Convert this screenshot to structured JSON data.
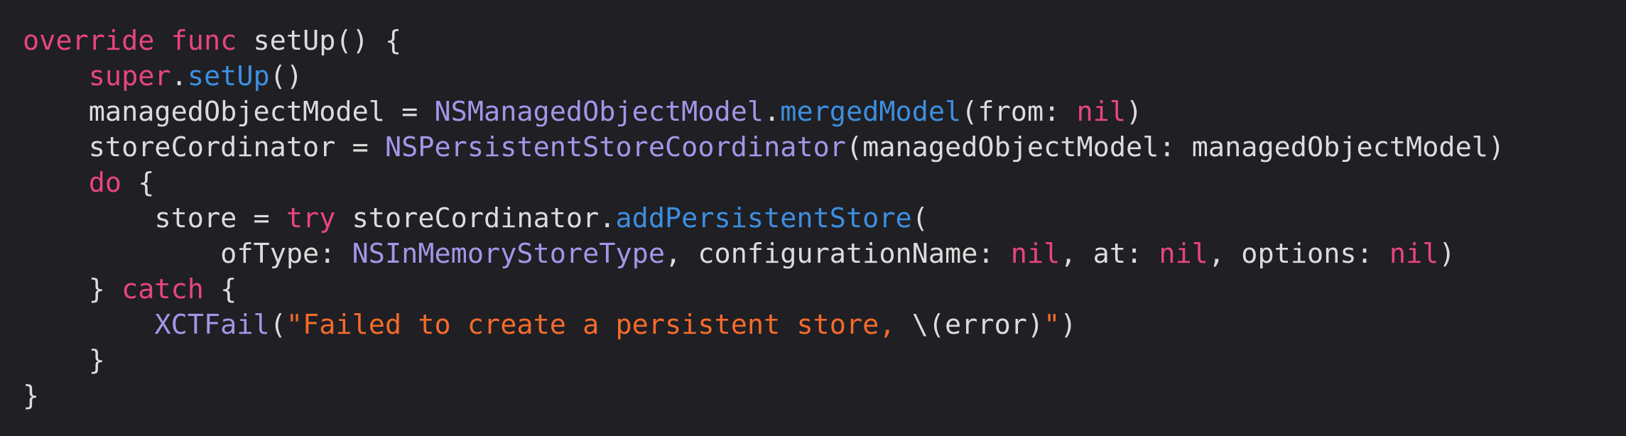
{
  "colors": {
    "background": "#1f1f24",
    "plain": "#dcdcdc",
    "keyword": "#e8457f",
    "type": "#a396e8",
    "function": "#3d8fe0",
    "string": "#f56b2b"
  },
  "code": {
    "lines": [
      {
        "indent": 0,
        "tokens": [
          {
            "kind": "kw",
            "text": "override func"
          },
          {
            "kind": "plain",
            "text": " setUp() {"
          }
        ]
      },
      {
        "indent": 1,
        "tokens": [
          {
            "kind": "kw",
            "text": "super"
          },
          {
            "kind": "plain",
            "text": "."
          },
          {
            "kind": "fn",
            "text": "setUp"
          },
          {
            "kind": "plain",
            "text": "()"
          }
        ]
      },
      {
        "indent": 1,
        "tokens": [
          {
            "kind": "plain",
            "text": "managedObjectModel = "
          },
          {
            "kind": "type",
            "text": "NSManagedObjectModel"
          },
          {
            "kind": "plain",
            "text": "."
          },
          {
            "kind": "fn",
            "text": "mergedModel"
          },
          {
            "kind": "plain",
            "text": "(from: "
          },
          {
            "kind": "kw",
            "text": "nil"
          },
          {
            "kind": "plain",
            "text": ")"
          }
        ]
      },
      {
        "indent": 1,
        "tokens": [
          {
            "kind": "plain",
            "text": "storeCordinator = "
          },
          {
            "kind": "type",
            "text": "NSPersistentStoreCoordinator"
          },
          {
            "kind": "plain",
            "text": "(managedObjectModel: managedObjectModel)"
          }
        ]
      },
      {
        "indent": 1,
        "tokens": [
          {
            "kind": "kw",
            "text": "do"
          },
          {
            "kind": "plain",
            "text": " {"
          }
        ]
      },
      {
        "indent": 2,
        "tokens": [
          {
            "kind": "plain",
            "text": "store = "
          },
          {
            "kind": "kw",
            "text": "try"
          },
          {
            "kind": "plain",
            "text": " storeCordinator."
          },
          {
            "kind": "fn",
            "text": "addPersistentStore"
          },
          {
            "kind": "plain",
            "text": "("
          }
        ]
      },
      {
        "indent": 3,
        "tokens": [
          {
            "kind": "plain",
            "text": "ofType: "
          },
          {
            "kind": "type",
            "text": "NSInMemoryStoreType"
          },
          {
            "kind": "plain",
            "text": ", configurationName: "
          },
          {
            "kind": "kw",
            "text": "nil"
          },
          {
            "kind": "plain",
            "text": ", at: "
          },
          {
            "kind": "kw",
            "text": "nil"
          },
          {
            "kind": "plain",
            "text": ", options: "
          },
          {
            "kind": "kw",
            "text": "nil"
          },
          {
            "kind": "plain",
            "text": ")"
          }
        ]
      },
      {
        "indent": 1,
        "tokens": [
          {
            "kind": "plain",
            "text": "} "
          },
          {
            "kind": "kw",
            "text": "catch"
          },
          {
            "kind": "plain",
            "text": " {"
          }
        ]
      },
      {
        "indent": 2,
        "tokens": [
          {
            "kind": "type",
            "text": "XCTFail"
          },
          {
            "kind": "plain",
            "text": "("
          },
          {
            "kind": "str",
            "text": "\"Failed to create a persistent store, "
          },
          {
            "kind": "plain",
            "text": "\\(error)"
          },
          {
            "kind": "str",
            "text": "\""
          },
          {
            "kind": "plain",
            "text": ")"
          }
        ]
      },
      {
        "indent": 1,
        "tokens": [
          {
            "kind": "plain",
            "text": "}"
          }
        ]
      },
      {
        "indent": 0,
        "tokens": [
          {
            "kind": "plain",
            "text": "}"
          }
        ]
      }
    ]
  }
}
